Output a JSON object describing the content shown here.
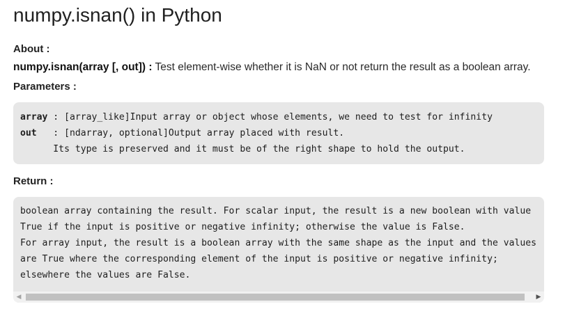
{
  "page": {
    "title": "numpy.isnan() in Python"
  },
  "about": {
    "label": "About :",
    "signature": "numpy.isnan(array [, out]) :",
    "description": " Test element-wise whether it is NaN or not return the result as a boolean array."
  },
  "parameters": {
    "label": "Parameters :",
    "lines": [
      {
        "name": "array",
        "sep": " : ",
        "text": "[array_like]Input array or object whose elements, we need to test for infinity"
      },
      {
        "name": "out",
        "sep": "   : ",
        "text": "[ndarray, optional]Output array placed with result."
      },
      {
        "name": "",
        "sep": "",
        "text": "      Its type is preserved and it must be of the right shape to hold the output."
      }
    ]
  },
  "returns": {
    "label": "Return :",
    "lines": [
      "boolean array containing the result. For scalar input, the result is a new boolean with value",
      "True if the input is positive or negative infinity; otherwise the value is False.",
      "For array input, the result is a boolean array with the same shape as the input and the values",
      "are True where the corresponding element of the input is positive or negative infinity;",
      "elsewhere the values are False."
    ]
  },
  "scrollbar": {
    "left_arrow_icon": "triangle-left-icon",
    "right_arrow_icon": "triangle-right-icon",
    "left_glyph": "◀",
    "right_glyph": "▶"
  }
}
